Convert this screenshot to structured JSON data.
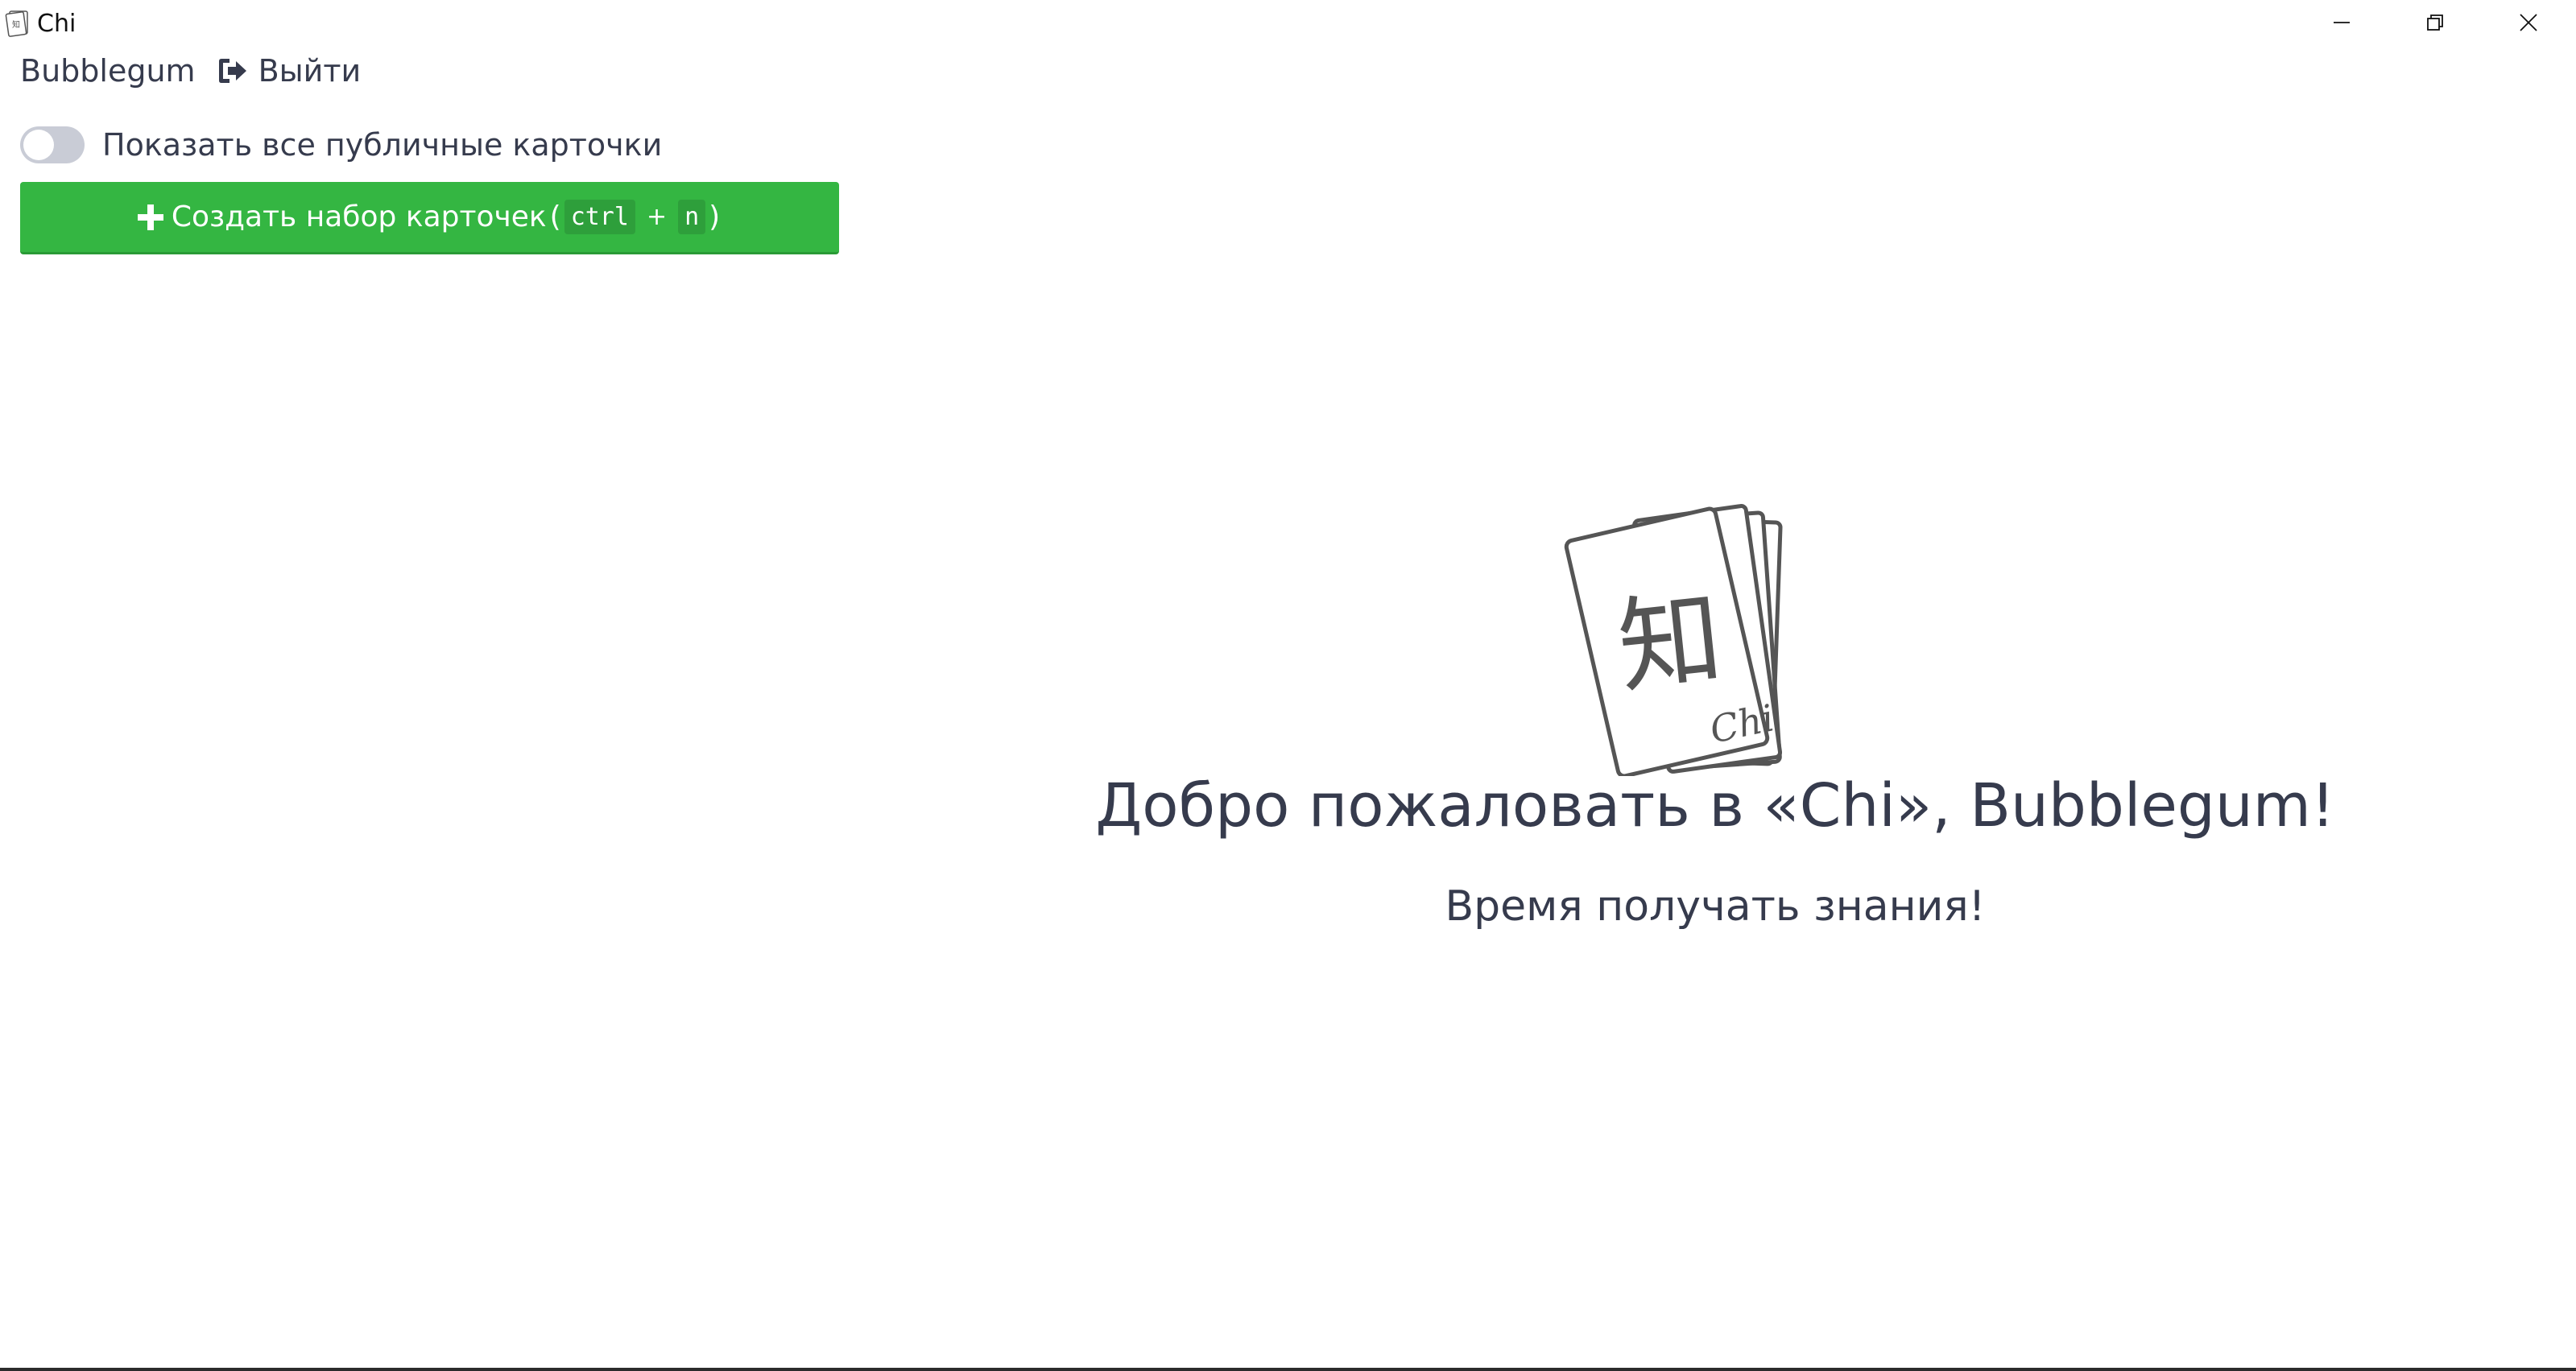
{
  "window": {
    "title": "Chi",
    "icon": "app-cards-icon"
  },
  "userbar": {
    "username": "Bubblegum",
    "logout_label": "Выйти",
    "logout_icon": "sign-out-icon"
  },
  "public_toggle": {
    "label": "Показать все публичные карточки",
    "checked": false
  },
  "create_button": {
    "label": "Создать набор карточек",
    "icon": "plus-icon",
    "open_paren": "(",
    "key1": "ctrl",
    "plus": "+",
    "key2": "n",
    "close_paren": ")"
  },
  "welcome": {
    "title": "Добро пожаловать в «Chi», Bubblegum!",
    "subtitle": "Время получать знания!",
    "logo_icon": "chi-cards-logo-icon"
  },
  "colors": {
    "accent_green": "#34b642",
    "text": "#363b4d",
    "toggle_off": "#c9ccd6"
  }
}
